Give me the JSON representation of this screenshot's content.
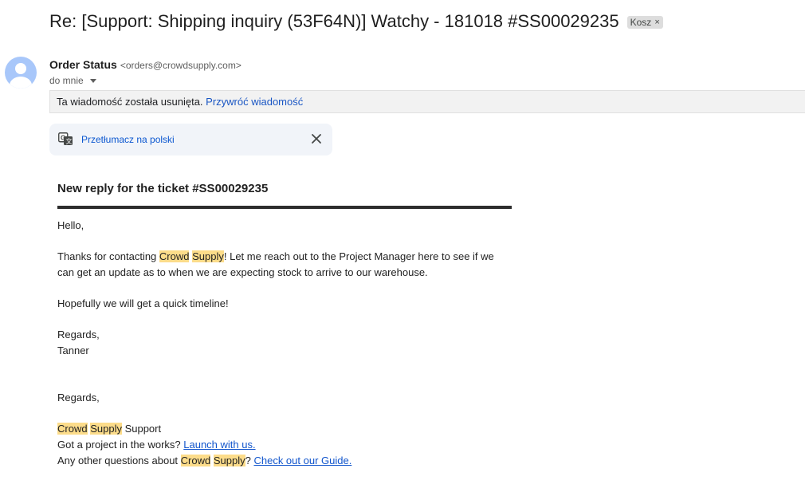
{
  "subject": "Re: [Support: Shipping inquiry (53F64N)] Watchy - 181018 #SS00029235",
  "label_chip": {
    "text": "Kosz",
    "close": "×"
  },
  "sender": {
    "name": "Order Status",
    "email": "<orders@crowdsupply.com>"
  },
  "recipient": "do mnie",
  "deleted_banner": {
    "text": "Ta wiadomość została usunięta. ",
    "restore_link": "Przywróć wiadomość"
  },
  "translate": {
    "link": "Przetłumacz na polski"
  },
  "body": {
    "title": "New reply for the ticket #SS00029235",
    "greeting": "Hello,",
    "p1_a": "Thanks for contacting ",
    "crowd": "Crowd",
    "supply": "Supply",
    "p1_b": "! Let me reach out to the Project Manager here to see if we can get an update as to when we are expecting stock to arrive to our warehouse.",
    "p2": "Hopefully we will get a quick timeline!",
    "regards": "Regards,",
    "signer": "Tanner",
    "regards2": "Regards,",
    "support_suffix": " Support",
    "project_q": "Got a project in the works? ",
    "launch_link": "Launch with us.",
    "other_q": "Any other questions about ",
    "q_mark": "? ",
    "guide_link": "Check out our Guide."
  },
  "colors": {
    "highlight": "#fcdc8a",
    "link": "#1155cc",
    "avatar": "#a8c7fa"
  }
}
